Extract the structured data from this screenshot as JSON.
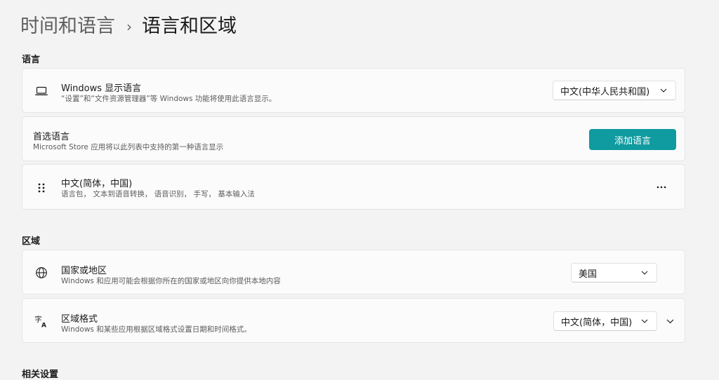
{
  "breadcrumb": {
    "parent": "时间和语言",
    "separator": "›",
    "current": "语言和区域"
  },
  "sections": {
    "language": "语言",
    "region": "区域",
    "related": "相关设置"
  },
  "display_language": {
    "icon": "laptop-icon",
    "title": "Windows 显示语言",
    "description": "“设置”和“文件资源管理器”等 Windows 功能将使用此语言显示。",
    "selected": "中文(中华人民共和国)"
  },
  "preferred_languages": {
    "title": "首选语言",
    "description": "Microsoft Store 应用将以此列表中支持的第一种语言显示",
    "add_button": "添加语言"
  },
  "language_item": {
    "icon": "drag-handle-icon",
    "title": "中文(简体，中国)",
    "features": "语言包， 文本到语音转换， 语音识别， 手写， 基本输入法",
    "more_icon": "more-options-icon"
  },
  "country_region": {
    "icon": "globe-icon",
    "title": "国家或地区",
    "description": "Windows 和应用可能会根据你所在的国家或地区向你提供本地内容",
    "selected": "美国"
  },
  "regional_format": {
    "icon": "language-format-icon",
    "title": "区域格式",
    "description": "Windows 和某些应用根据区域格式设置日期和时间格式。",
    "selected": "中文(简体，中国)"
  },
  "colors": {
    "accent": "#0f9ba0",
    "background": "#f3f3f3",
    "card": "#fbfbfb"
  }
}
